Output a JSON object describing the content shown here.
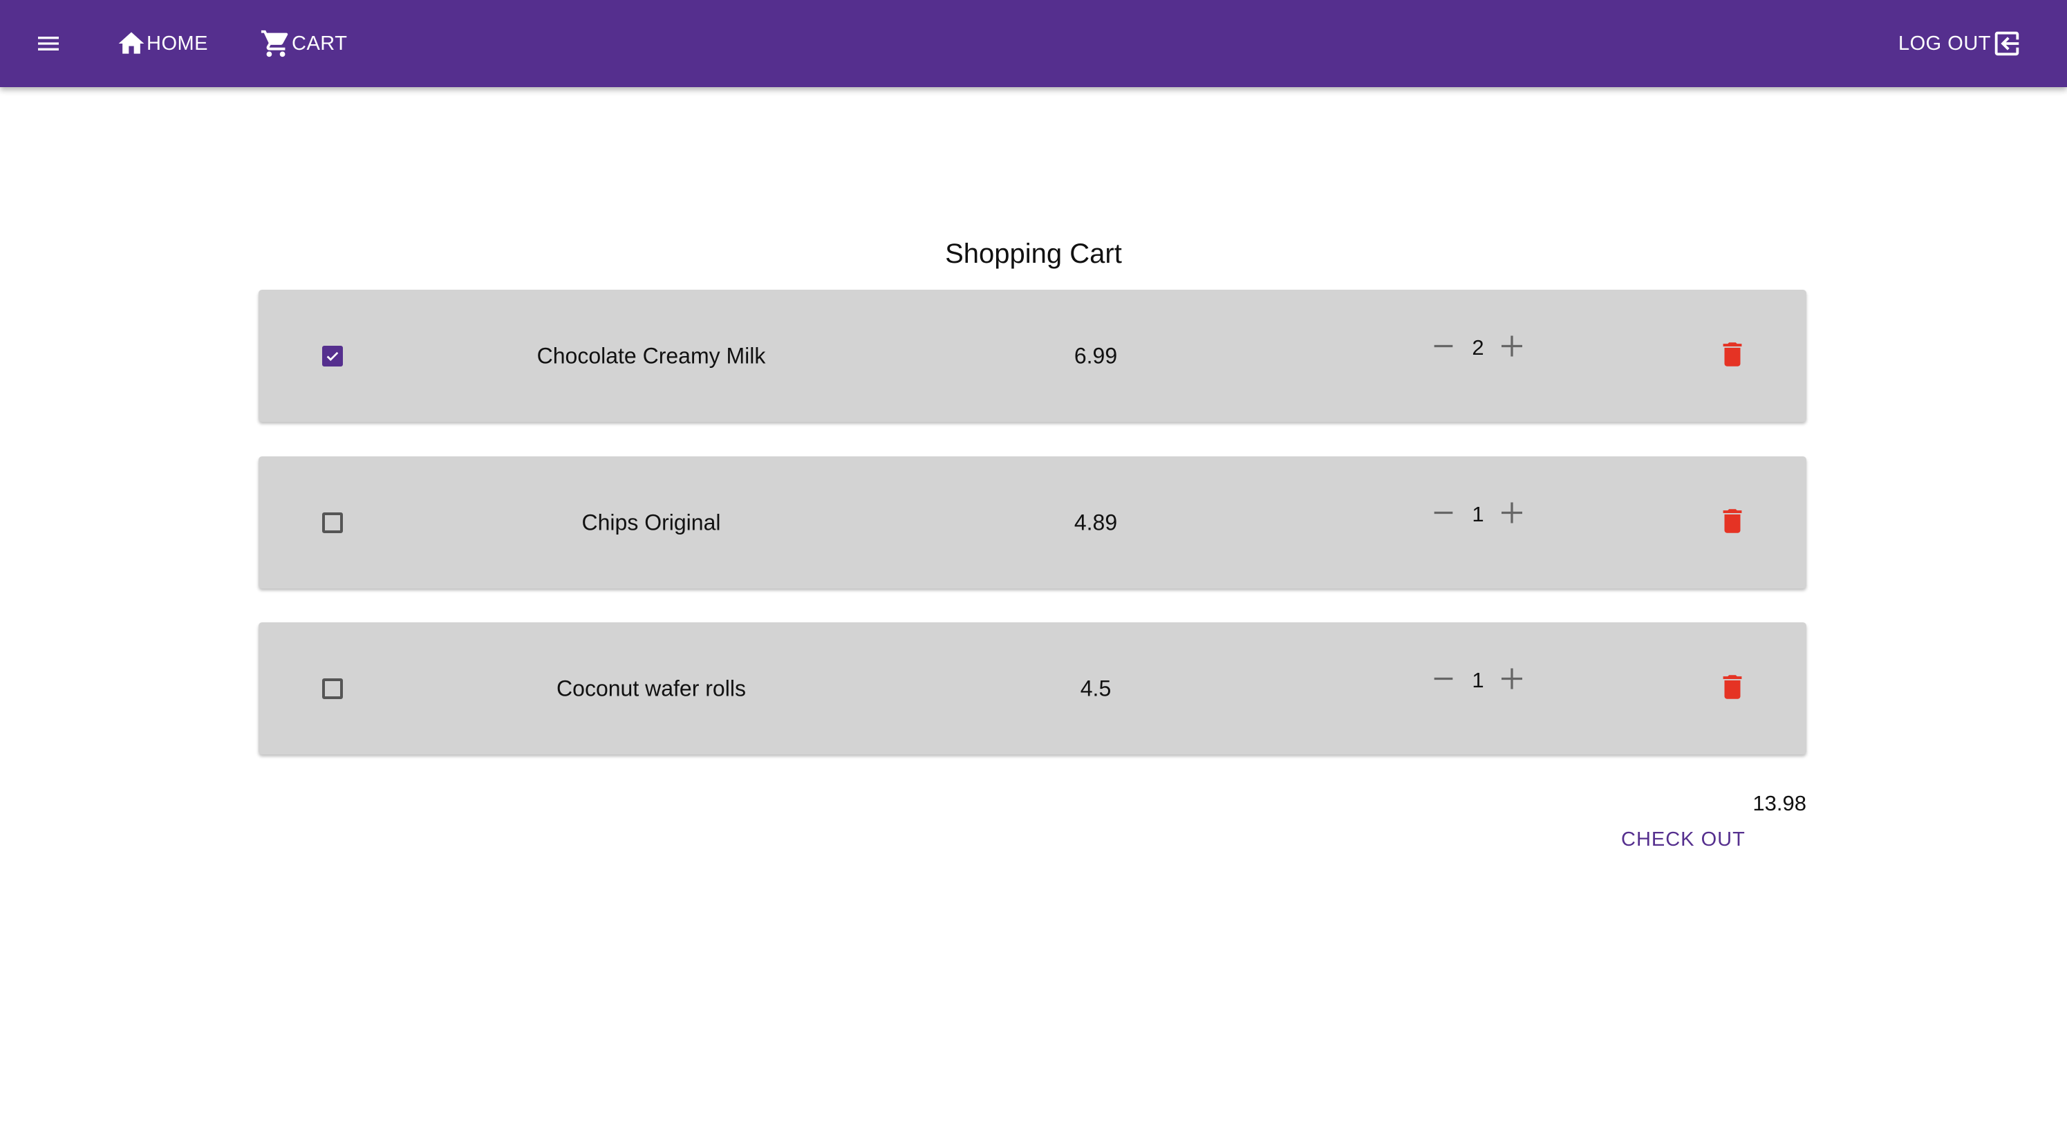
{
  "header": {
    "menu_icon": "hamburger-menu-icon",
    "home_label": "HOME",
    "cart_label": "CART",
    "logout_label": "LOG OUT",
    "brand_color": "#552f8e"
  },
  "title": "Shopping Cart",
  "items": [
    {
      "name": "Chocolate Creamy Milk",
      "price": "6.99",
      "quantity": "2",
      "checked": true
    },
    {
      "name": "Chips Original",
      "price": "4.89",
      "quantity": "1",
      "checked": false
    },
    {
      "name": "Coconut wafer rolls",
      "price": "4.5",
      "quantity": "1",
      "checked": false
    }
  ],
  "total": "13.98",
  "checkout_label": "CHECK OUT",
  "delete_color": "#e53324"
}
